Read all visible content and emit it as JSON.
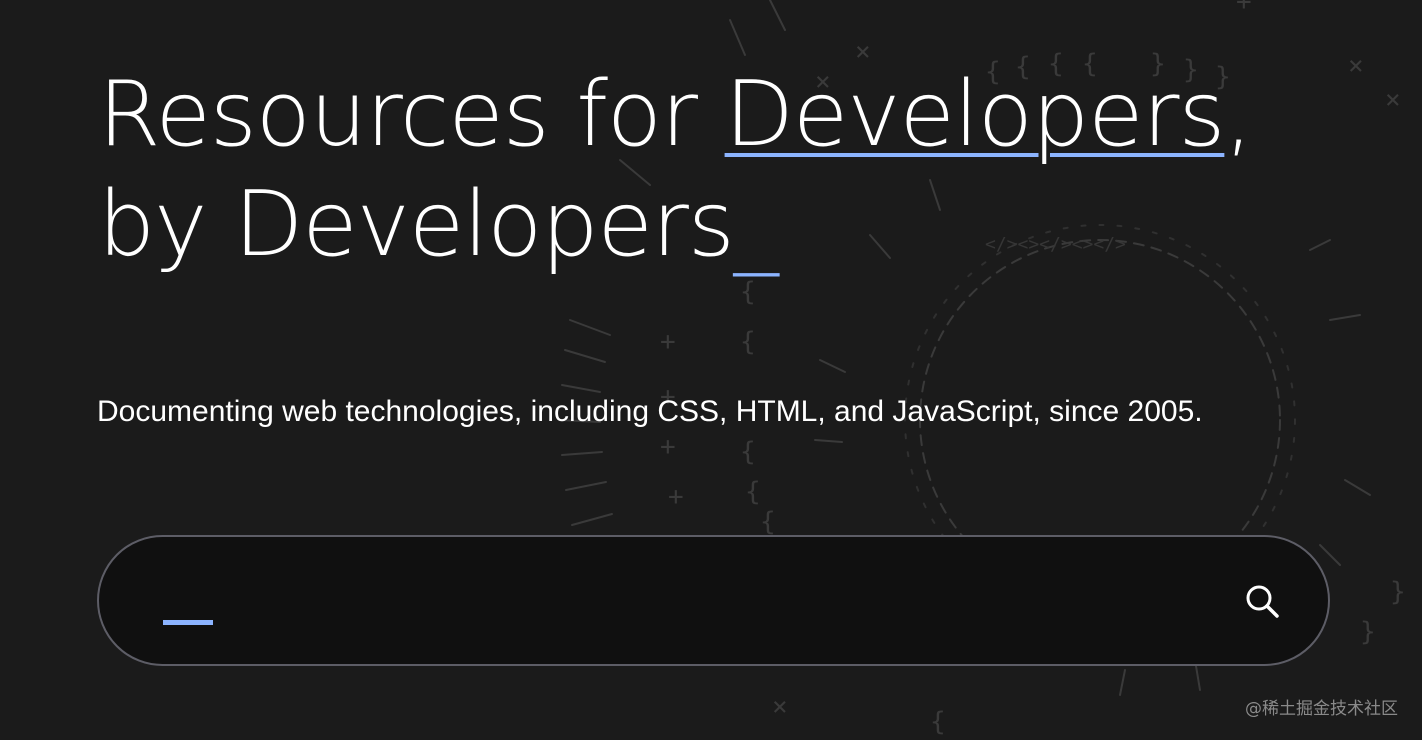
{
  "hero": {
    "title_prefix": "Resources for ",
    "title_link": "Developers",
    "title_comma": ",",
    "title_line2": "by Developers",
    "title_cursor": "_",
    "tagline": "Documenting web technologies, including CSS, HTML, and JavaScript, since 2005."
  },
  "search": {
    "value": "",
    "placeholder": "",
    "icon": "search-icon"
  },
  "watermark": {
    "text": "@稀土掘金技术社区"
  },
  "colors": {
    "background": "#1b1b1b",
    "accent": "#8cb4ff",
    "search_background": "#101010",
    "search_border": "#5d5d66",
    "text": "#ffffff"
  }
}
